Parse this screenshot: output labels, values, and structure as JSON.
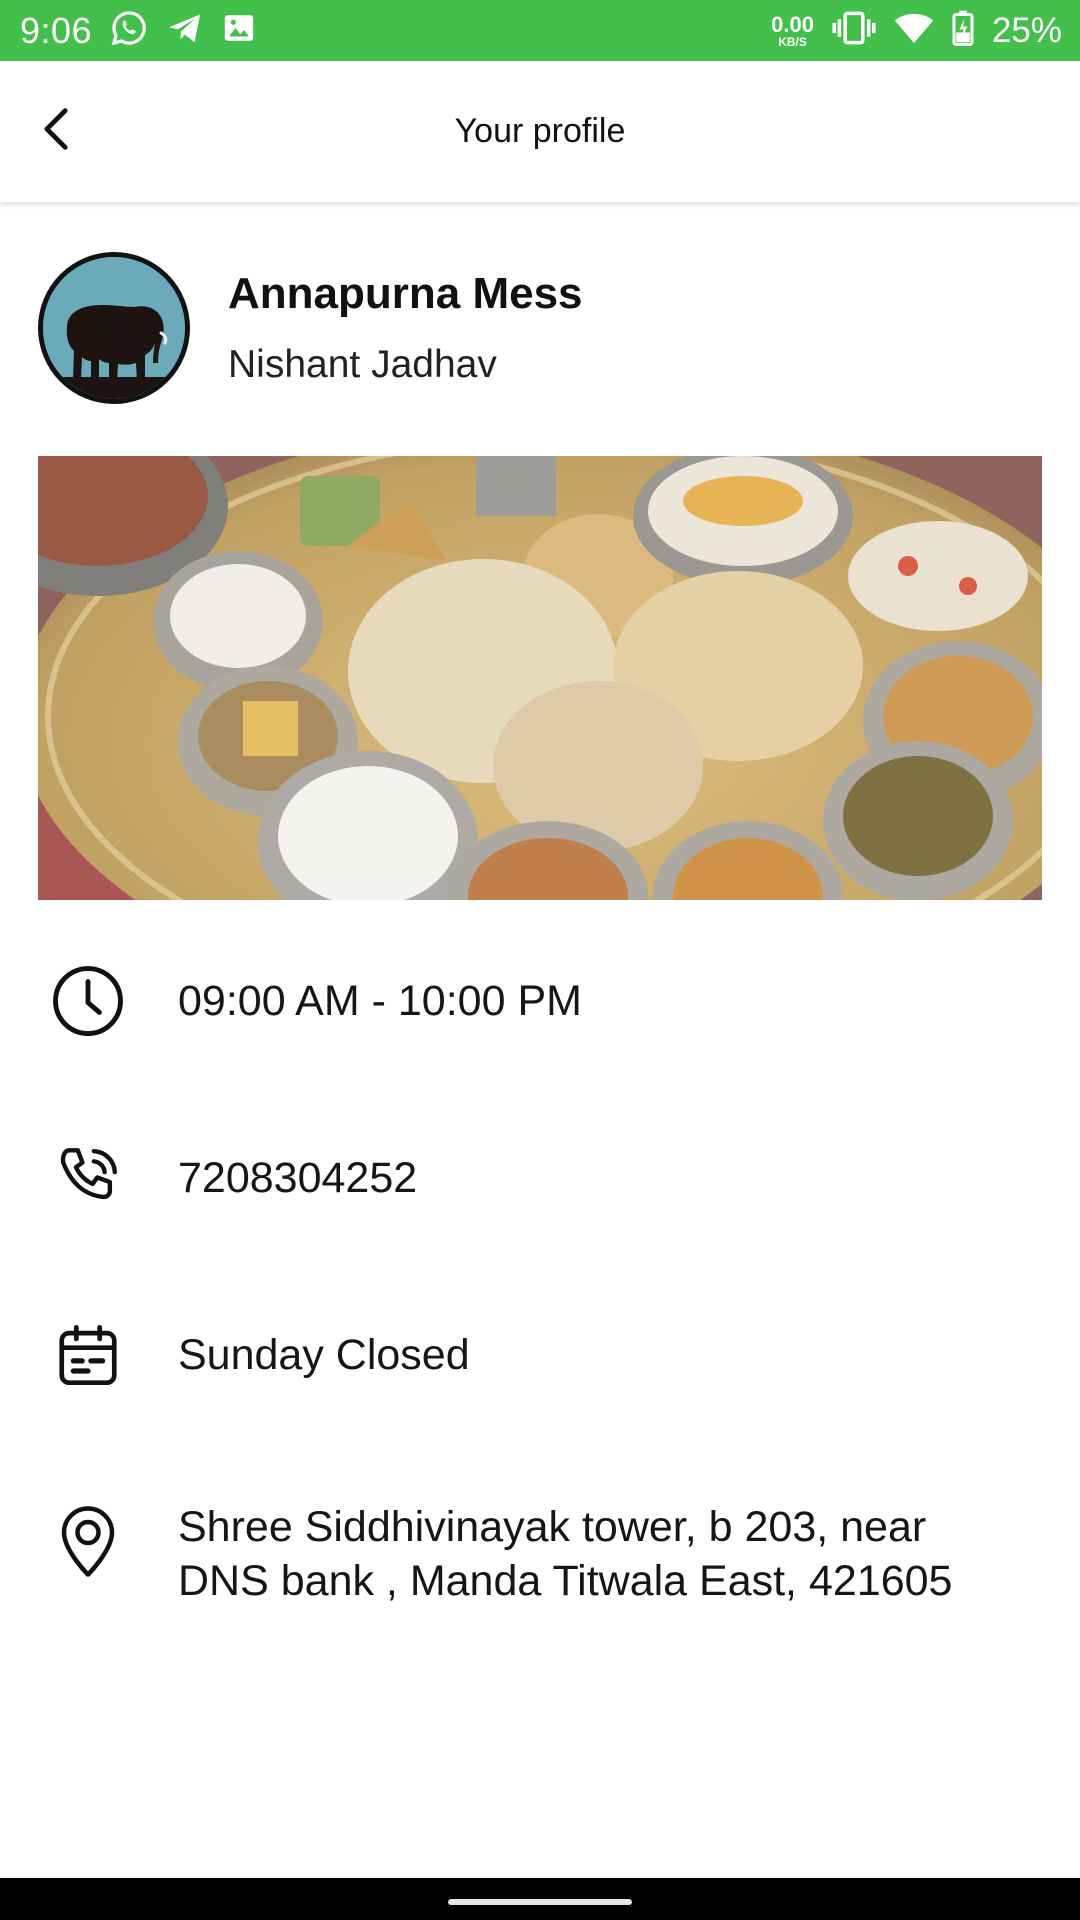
{
  "status_bar": {
    "time": "9:06",
    "net_speed_value": "0.00",
    "net_speed_unit": "KB/S",
    "battery_pct": "25%",
    "background": "#43c04c",
    "left_icons": [
      "whatsapp-icon",
      "telegram-icon",
      "gallery-icon"
    ],
    "right_icons": [
      "vibrate-icon",
      "wifi-icon",
      "battery-charging-icon"
    ]
  },
  "app_bar": {
    "title": "Your profile",
    "back_icon": "chevron-left-icon"
  },
  "profile": {
    "business_name": "Annapurna Mess",
    "owner_name": "Nishant Jadhav",
    "avatar_icon": "elephant-icon"
  },
  "banner": {
    "description_icon": "thali-photo"
  },
  "info": {
    "hours": "09:00 AM  -  10:00 PM",
    "phone": "7208304252",
    "holiday": "Sunday Closed",
    "address": "Shree Siddhivinayak tower, b 203, near DNS bank , Manda Titwala East, 421605"
  }
}
